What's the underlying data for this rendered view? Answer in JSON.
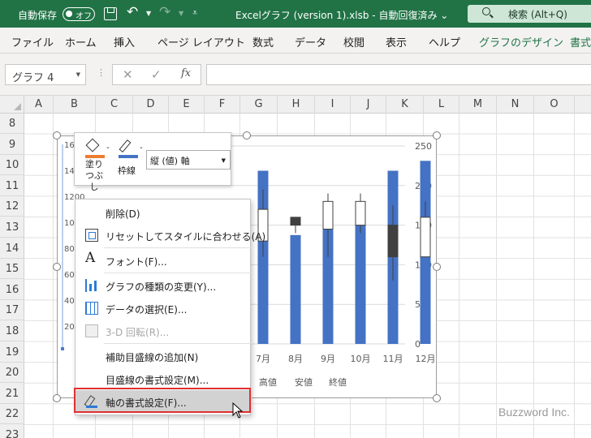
{
  "titlebar": {
    "autosave_label": "自動保存",
    "autosave_state": "オフ",
    "doc_title": "Excelグラフ (version 1).xlsb  -  自動回復済み  ⌄",
    "search_text": "検索 (Alt+Q)"
  },
  "ribbon": {
    "tabs": [
      "ファイル",
      "ホーム",
      "挿入",
      "ページ レイアウト",
      "数式",
      "データ",
      "校閲",
      "表示",
      "ヘルプ",
      "グラフのデザイン",
      "書式"
    ]
  },
  "formula_bar": {
    "name_box": "グラフ 4",
    "fx_label": "fx"
  },
  "grid": {
    "columns": [
      "A",
      "B",
      "C",
      "D",
      "E",
      "F",
      "G",
      "H",
      "I",
      "J",
      "K",
      "L",
      "M",
      "N",
      "O"
    ],
    "rows": [
      "8",
      "9",
      "10",
      "11",
      "12",
      "13",
      "14",
      "15",
      "16",
      "17",
      "18",
      "19",
      "20",
      "21",
      "22",
      "23"
    ]
  },
  "chart_data": {
    "type": "bar",
    "categories": [
      "7月",
      "8月",
      "9月",
      "10月",
      "11月",
      "12月"
    ],
    "series": [
      {
        "name": "",
        "values": [
          875,
          550,
          700,
          700,
          875,
          925
        ]
      }
    ],
    "candlestick": [
      {
        "label": "7月",
        "high": 195,
        "low": 110,
        "open": 130,
        "close": 170
      },
      {
        "label": "8月",
        "high": 160,
        "low": 140,
        "open": 160,
        "close": 150
      },
      {
        "label": "9月",
        "high": 190,
        "low": 110,
        "open": 145,
        "close": 180
      },
      {
        "label": "10月",
        "high": 190,
        "low": 140,
        "open": 150,
        "close": 180
      },
      {
        "label": "11月",
        "high": 175,
        "low": 80,
        "open": 150,
        "close": 110
      },
      {
        "label": "12月",
        "high": 180,
        "low": 110,
        "open": 110,
        "close": 160
      }
    ],
    "y_left_ticks_visible": [
      "1600",
      "1400",
      "1200",
      "1000",
      "800",
      "600",
      "400",
      "200"
    ],
    "y_right_ticks": [
      "250",
      "200",
      "150",
      "100",
      "50",
      "0"
    ],
    "y_right_range": [
      0,
      250
    ],
    "y_left_range": [
      0,
      1000
    ],
    "legend_partial": [
      "高値",
      "安値",
      "終値"
    ],
    "legend_placement": "bottom"
  },
  "mini_toolbar": {
    "fill_label": "塗りつぶし",
    "outline_label": "枠線",
    "element_select": "縦 (値) 軸",
    "fill_color": "#ed7d31",
    "outline_color": "#4472c4"
  },
  "context_menu": {
    "items": [
      {
        "label": "削除(D)",
        "icon": "none",
        "enabled": true
      },
      {
        "label": "リセットしてスタイルに合わせる(A)",
        "icon": "reset-icon",
        "enabled": true
      },
      {
        "label": "フォント(F)...",
        "icon": "font-icon",
        "enabled": true
      },
      {
        "label": "グラフの種類の変更(Y)...",
        "icon": "chart-type-icon",
        "enabled": true
      },
      {
        "label": "データの選択(E)...",
        "icon": "select-data-icon",
        "enabled": true
      },
      {
        "label": "3-D 回転(R)...",
        "icon": "rotate-3d-icon",
        "enabled": false
      },
      {
        "label": "補助目盛線の追加(N)",
        "icon": "none",
        "enabled": true
      },
      {
        "label": "目盛線の書式設定(M)...",
        "icon": "none",
        "enabled": true
      },
      {
        "label": "軸の書式設定(F)...",
        "icon": "format-axis-icon",
        "enabled": true
      }
    ]
  },
  "watermark": "Buzzword Inc.",
  "colors": {
    "excel_green": "#217346",
    "bar_blue": "#4472c4",
    "candle_dark": "#404040",
    "highlight_red": "#e03030"
  }
}
